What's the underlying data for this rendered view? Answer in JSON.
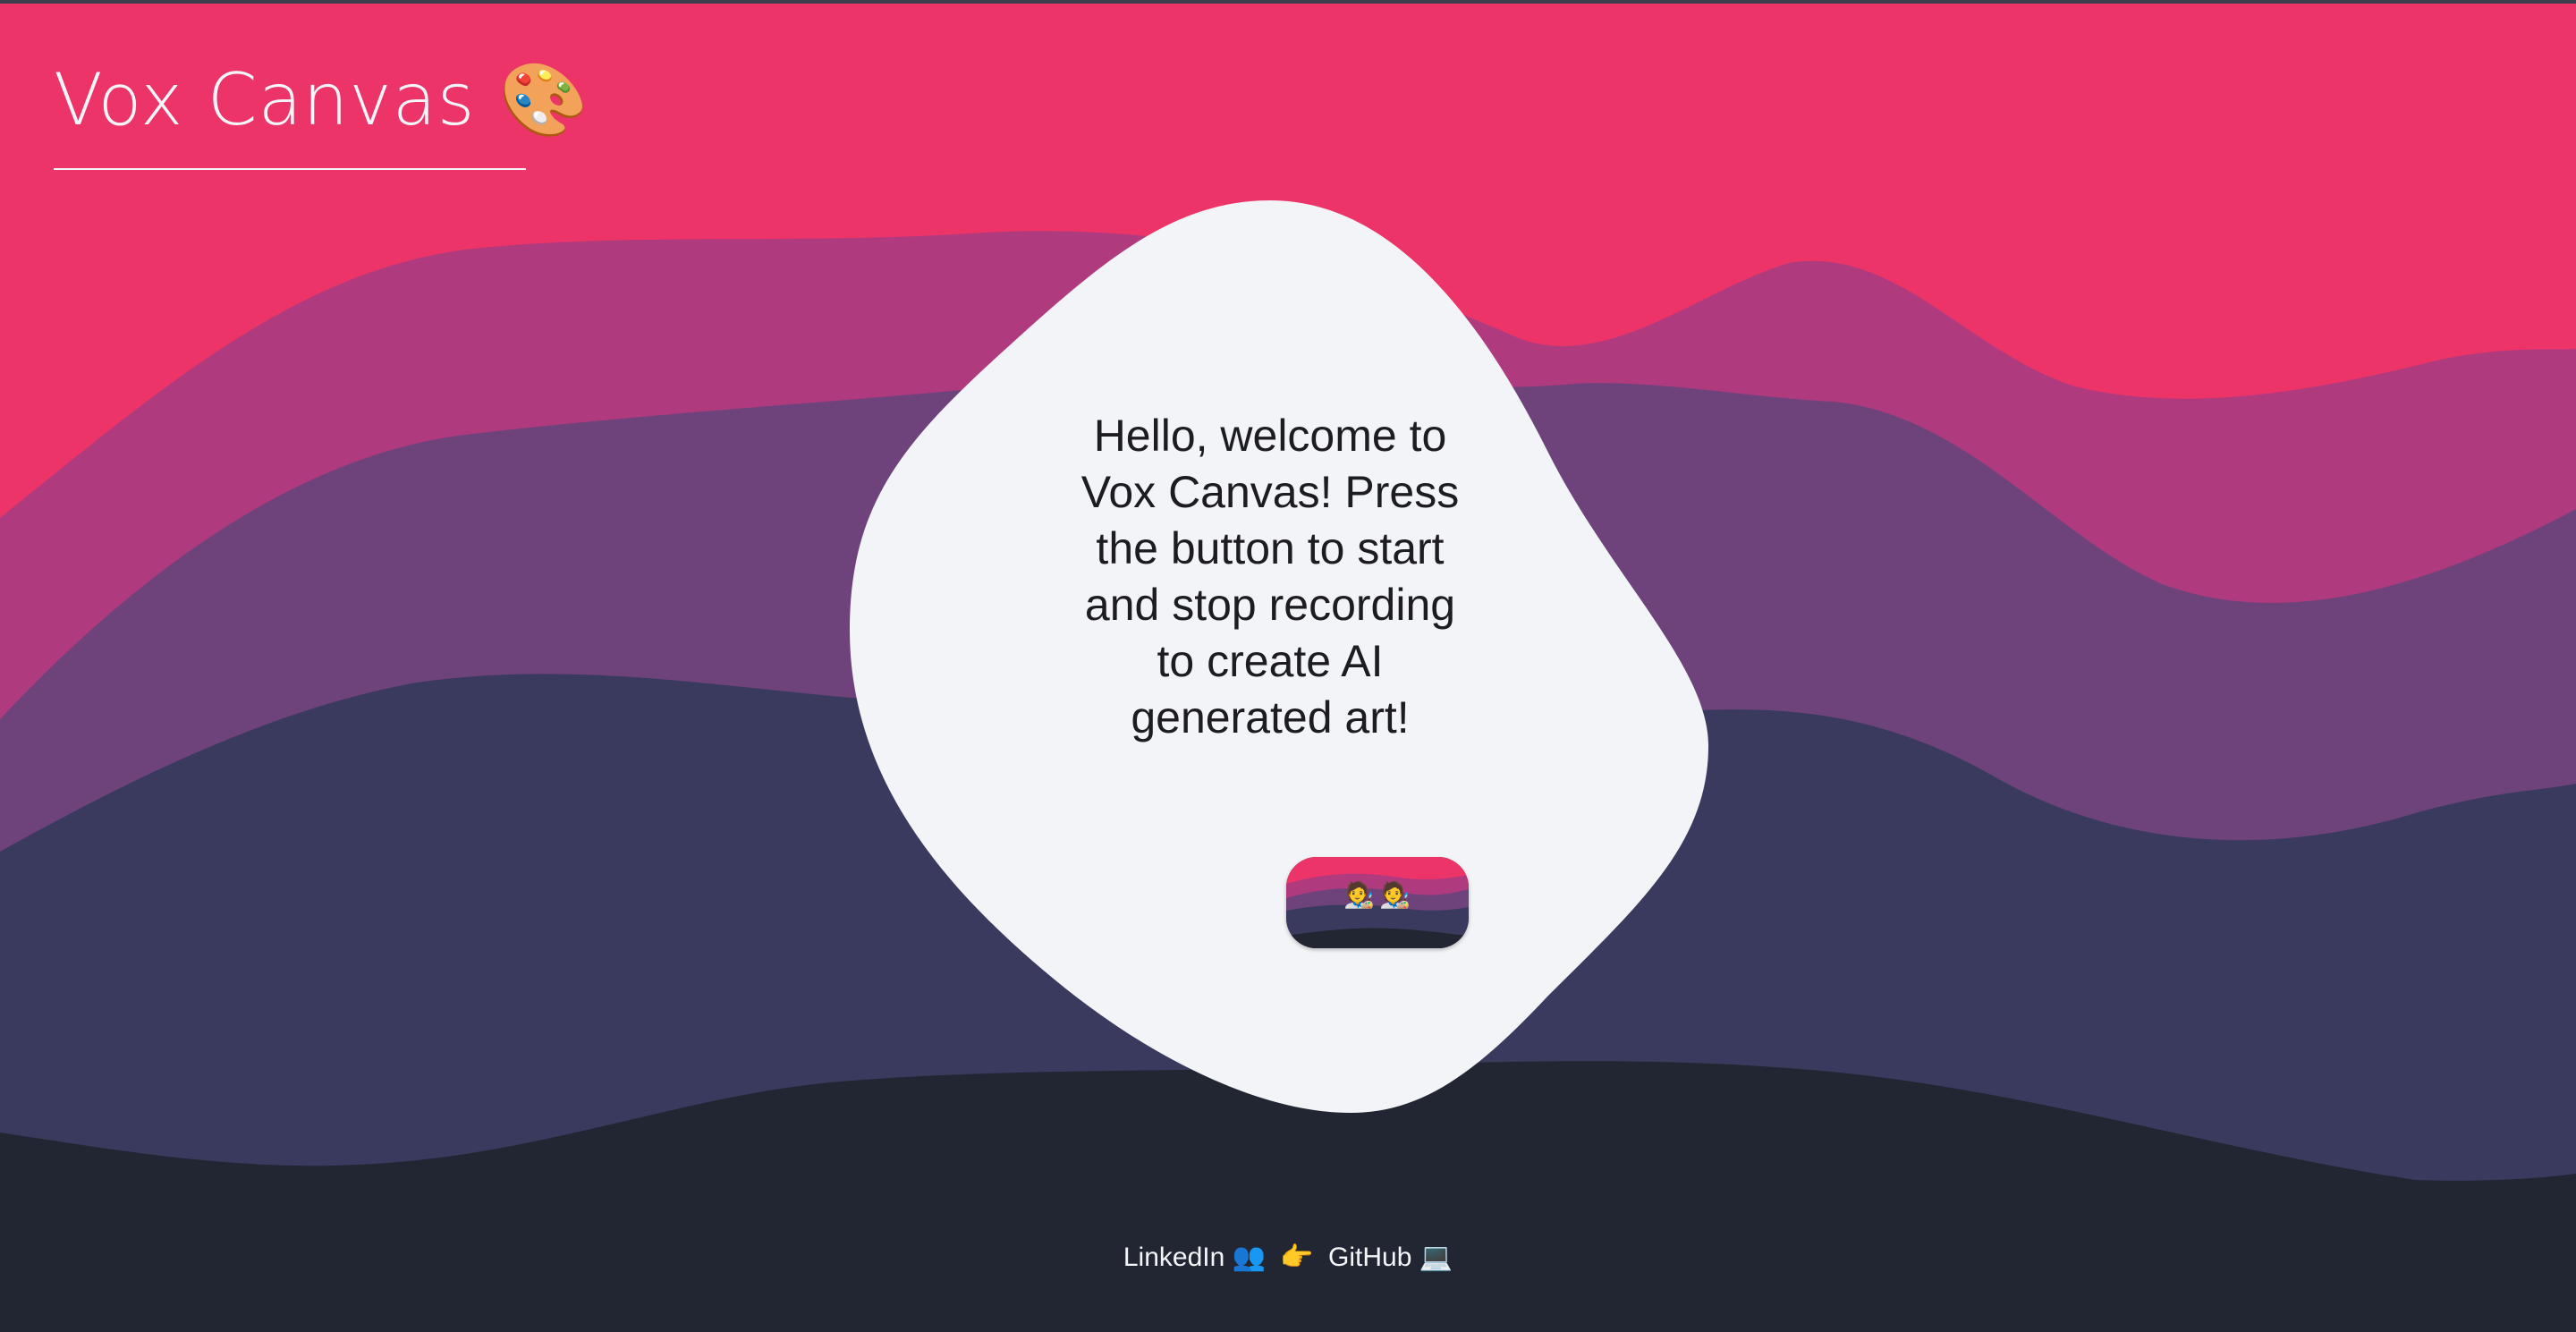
{
  "header": {
    "title": "Vox Canvas 🎨"
  },
  "welcome": {
    "message": "Hello, welcome to Vox Canvas! Press the button to start and stop recording to create AI generated art!"
  },
  "record_button": {
    "icon_left": "🧑‍🎨",
    "icon_right": "🧑‍🎨"
  },
  "footer": {
    "linkedin_label": "LinkedIn 👥",
    "separator": "👉",
    "github_label": "GitHub 💻"
  },
  "colors": {
    "wave_pink": "#ec3468",
    "wave_magenta": "#b03a7e",
    "wave_purple": "#6e437c",
    "wave_indigo": "#393a5e",
    "wave_dark": "#222632",
    "blob_fill": "#f3f4f7",
    "title_text": "#f4f5f8",
    "body_text": "#1c1c22"
  }
}
